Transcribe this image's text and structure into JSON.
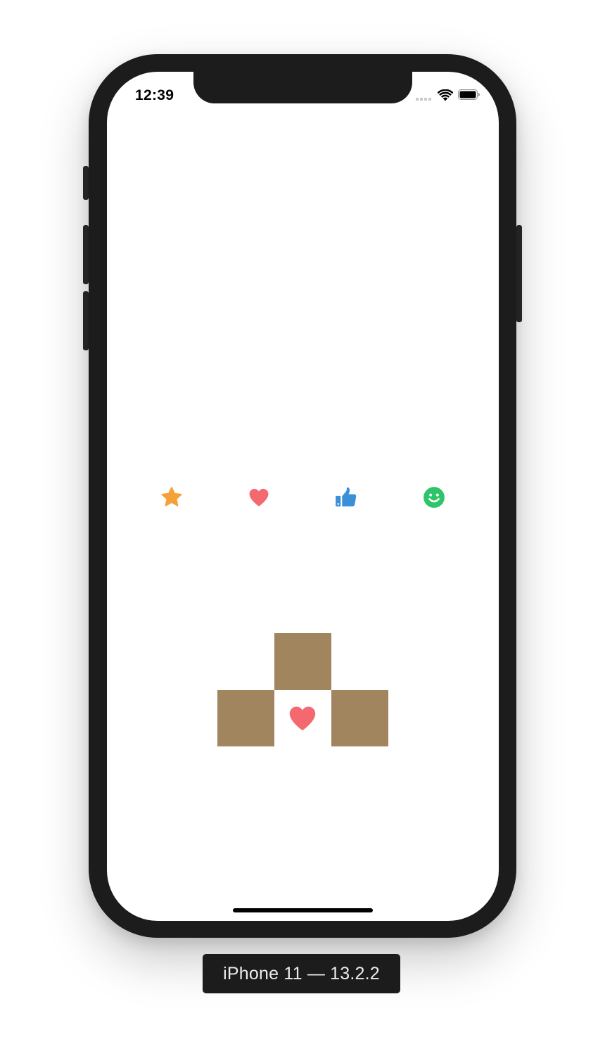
{
  "device_label": "iPhone 11 — 13.2.2",
  "status_bar": {
    "time": "12:39",
    "signal_icon": "cellular-signal-icon",
    "wifi_icon": "wifi-icon",
    "battery_icon": "battery-icon"
  },
  "reaction_icons": [
    {
      "name": "star-icon",
      "color": "#f6a03a"
    },
    {
      "name": "heart-icon",
      "color": "#f4686f"
    },
    {
      "name": "thumbs-up-icon",
      "color": "#3b8fd9"
    },
    {
      "name": "smile-icon",
      "color": "#2ec56a"
    }
  ],
  "blocks": {
    "color": "#a0855f",
    "center_icon": "heart-icon",
    "center_icon_color": "#f4686f"
  },
  "colors": {
    "frame": "#1c1c1c",
    "screen": "#ffffff",
    "home_indicator": "#000000"
  }
}
